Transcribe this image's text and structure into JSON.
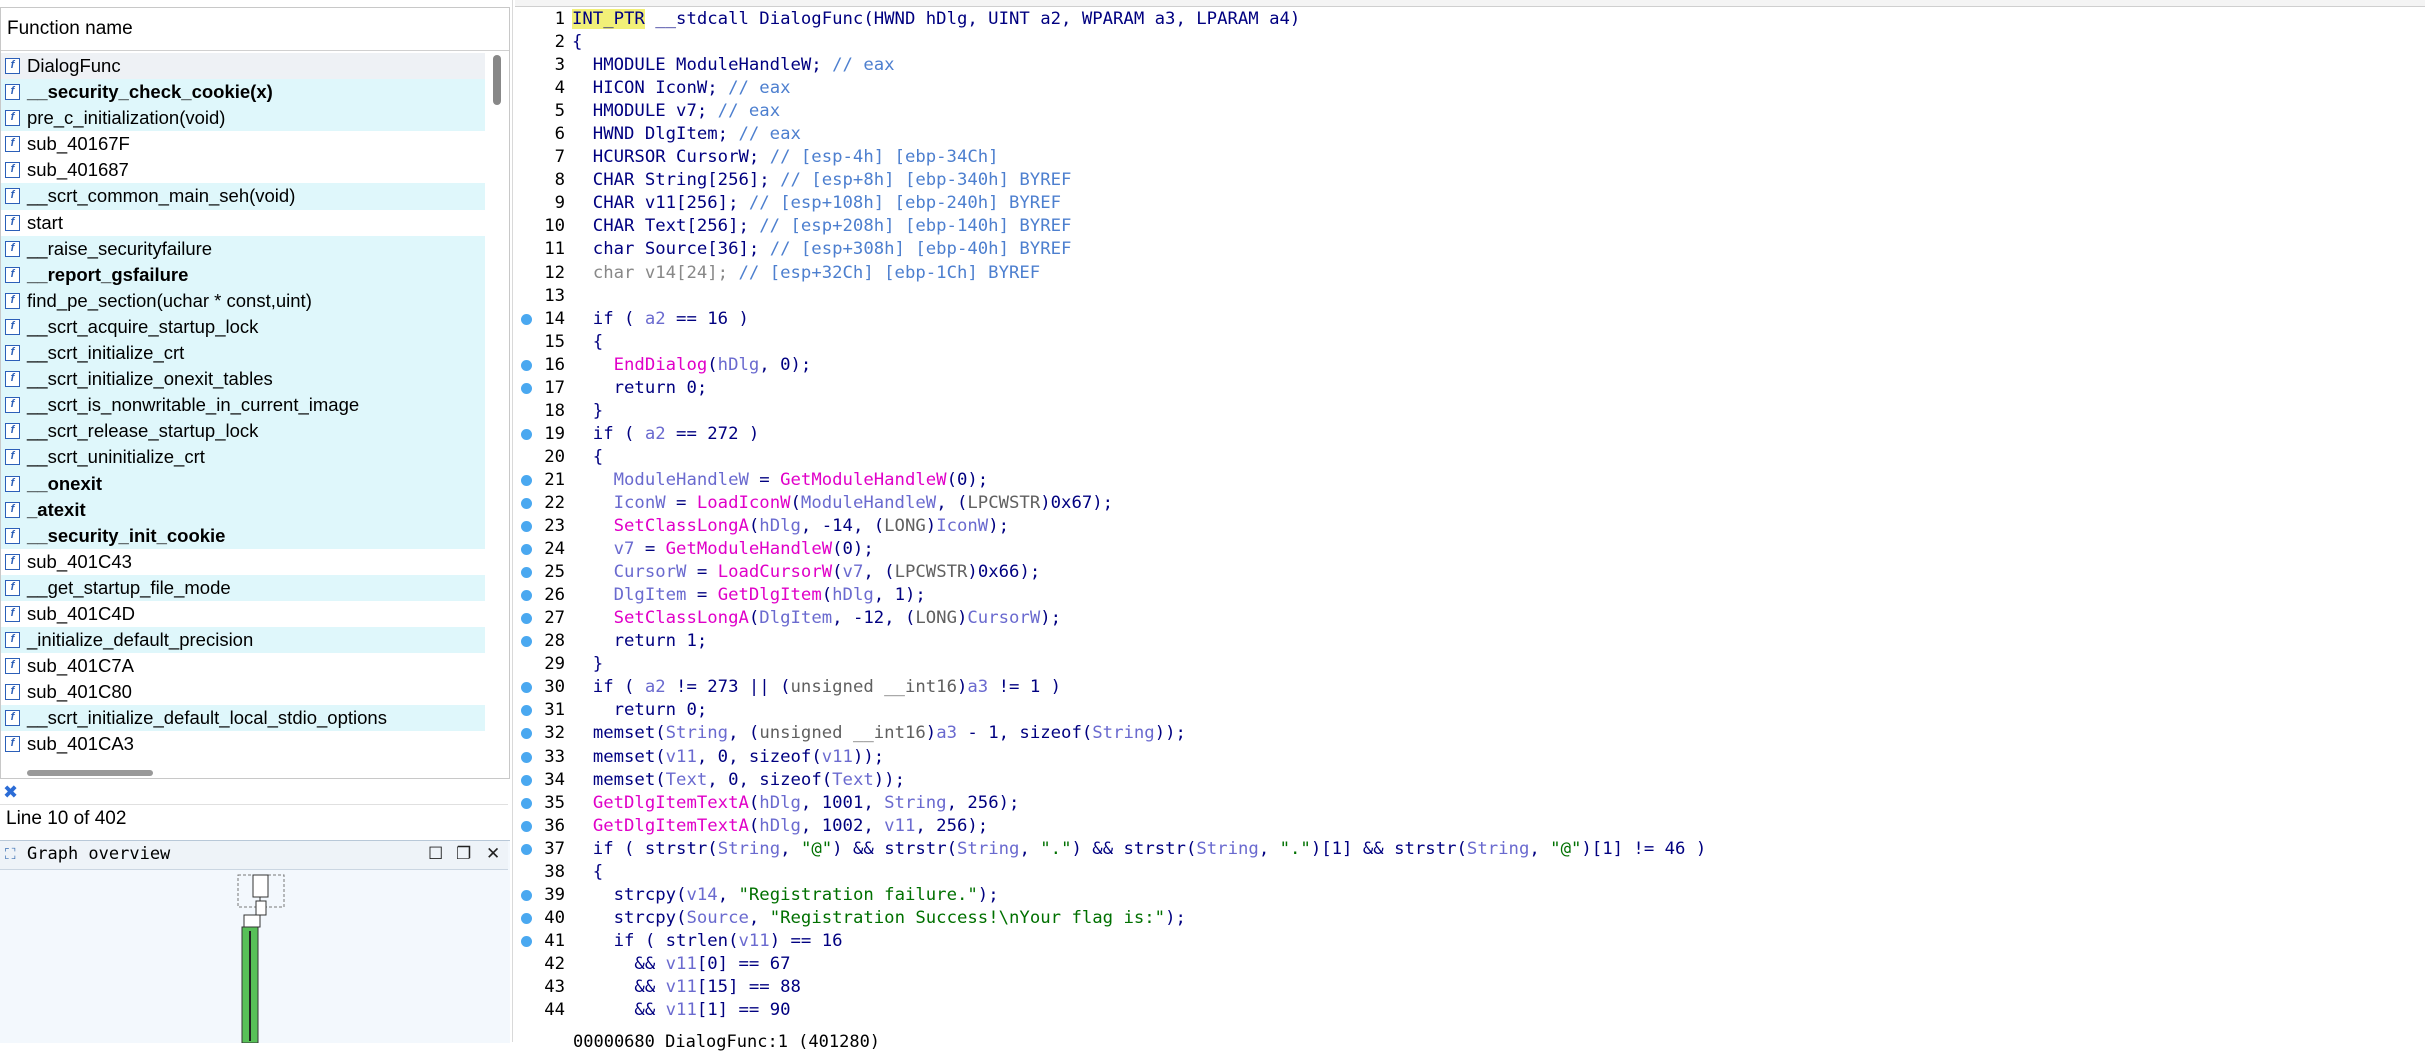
{
  "functions_panel": {
    "header": "Function name",
    "items": [
      {
        "name": "DialogFunc",
        "bold": false,
        "lib": false,
        "sel": true
      },
      {
        "name": "__security_check_cookie(x)",
        "bold": true,
        "lib": true
      },
      {
        "name": "pre_c_initialization(void)",
        "bold": false,
        "lib": true
      },
      {
        "name": "sub_40167F",
        "bold": false,
        "lib": false
      },
      {
        "name": "sub_401687",
        "bold": false,
        "lib": false
      },
      {
        "name": "__scrt_common_main_seh(void)",
        "bold": false,
        "lib": true
      },
      {
        "name": "start",
        "bold": false,
        "lib": false
      },
      {
        "name": "__raise_securityfailure",
        "bold": false,
        "lib": true
      },
      {
        "name": "__report_gsfailure",
        "bold": true,
        "lib": true
      },
      {
        "name": "find_pe_section(uchar * const,uint)",
        "bold": false,
        "lib": true
      },
      {
        "name": "__scrt_acquire_startup_lock",
        "bold": false,
        "lib": true
      },
      {
        "name": "__scrt_initialize_crt",
        "bold": false,
        "lib": true
      },
      {
        "name": "__scrt_initialize_onexit_tables",
        "bold": false,
        "lib": true
      },
      {
        "name": "__scrt_is_nonwritable_in_current_image",
        "bold": false,
        "lib": true
      },
      {
        "name": "__scrt_release_startup_lock",
        "bold": false,
        "lib": true
      },
      {
        "name": "__scrt_uninitialize_crt",
        "bold": false,
        "lib": true
      },
      {
        "name": "__onexit",
        "bold": true,
        "lib": true
      },
      {
        "name": "_atexit",
        "bold": true,
        "lib": true
      },
      {
        "name": "__security_init_cookie",
        "bold": true,
        "lib": true
      },
      {
        "name": "sub_401C43",
        "bold": false,
        "lib": false
      },
      {
        "name": "__get_startup_file_mode",
        "bold": false,
        "lib": true
      },
      {
        "name": "sub_401C4D",
        "bold": false,
        "lib": false
      },
      {
        "name": "_initialize_default_precision",
        "bold": false,
        "lib": true
      },
      {
        "name": "sub_401C7A",
        "bold": false,
        "lib": false
      },
      {
        "name": "sub_401C80",
        "bold": false,
        "lib": false
      },
      {
        "name": "__scrt_initialize_default_local_stdio_options",
        "bold": false,
        "lib": true
      },
      {
        "name": "sub_401CA3",
        "bold": false,
        "lib": false
      }
    ]
  },
  "status": {
    "line_count": "Line 10 of 402",
    "bottom_address": "00000680 DialogFunc:1 (401280)"
  },
  "graph_overview": {
    "title": "Graph overview",
    "icon": "graph-icon"
  },
  "code_lines": [
    {
      "n": "1",
      "dot": false,
      "html": "<span class=\"hl\">INT_PTR</span> __stdcall DialogFunc(HWND hDlg, UINT a2, WPARAM a3, LPARAM a4)"
    },
    {
      "n": "2",
      "dot": false,
      "html": "{"
    },
    {
      "n": "3",
      "dot": false,
      "html": "  HMODULE ModuleHandleW; <span class=\"cmt\">// eax</span>"
    },
    {
      "n": "4",
      "dot": false,
      "html": "  HICON IconW; <span class=\"cmt\">// eax</span>"
    },
    {
      "n": "5",
      "dot": false,
      "html": "  HMODULE v7; <span class=\"cmt\">// eax</span>"
    },
    {
      "n": "6",
      "dot": false,
      "html": "  HWND DlgItem; <span class=\"cmt\">// eax</span>"
    },
    {
      "n": "7",
      "dot": false,
      "html": "  HCURSOR CursorW; <span class=\"cmt\">// [esp-4h] [ebp-34Ch]</span>"
    },
    {
      "n": "8",
      "dot": false,
      "html": "  CHAR String[256]; <span class=\"cmt\">// [esp+8h] [ebp-340h] BYREF</span>"
    },
    {
      "n": "9",
      "dot": false,
      "html": "  CHAR v11[256]; <span class=\"cmt\">// [esp+108h] [ebp-240h] BYREF</span>"
    },
    {
      "n": "10",
      "dot": false,
      "html": "  CHAR Text[256]; <span class=\"cmt\">// [esp+208h] [ebp-140h] BYREF</span>"
    },
    {
      "n": "11",
      "dot": false,
      "html": "  char Source[36]; <span class=\"cmt\">// [esp+308h] [ebp-40h] BYREF</span>"
    },
    {
      "n": "12",
      "dot": false,
      "html": "  <span class=\"cmtv\">char v14[24];</span> <span class=\"cmt\">// [esp+32Ch] [ebp-1Ch] BYREF</span>"
    },
    {
      "n": "13",
      "dot": false,
      "html": ""
    },
    {
      "n": "14",
      "dot": true,
      "html": "  if ( <span class=\"var\">a2</span> == 16 )"
    },
    {
      "n": "15",
      "dot": false,
      "html": "  {"
    },
    {
      "n": "16",
      "dot": true,
      "html": "    <span class=\"fn\">EndDialog</span>(<span class=\"var\">hDlg</span>, 0);"
    },
    {
      "n": "17",
      "dot": true,
      "html": "    return 0;"
    },
    {
      "n": "18",
      "dot": false,
      "html": "  }"
    },
    {
      "n": "19",
      "dot": true,
      "html": "  if ( <span class=\"var\">a2</span> == 272 )"
    },
    {
      "n": "20",
      "dot": false,
      "html": "  {"
    },
    {
      "n": "21",
      "dot": true,
      "html": "    <span class=\"var\">ModuleHandleW</span> = <span class=\"fn\">GetModuleHandleW</span>(0);"
    },
    {
      "n": "22",
      "dot": true,
      "html": "    <span class=\"var\">IconW</span> = <span class=\"fn\">LoadIconW</span>(<span class=\"var\">ModuleHandleW</span>, (<span class=\"cast\">LPCWSTR</span>)0x67);"
    },
    {
      "n": "23",
      "dot": true,
      "html": "    <span class=\"fn\">SetClassLongA</span>(<span class=\"var\">hDlg</span>, -14, (<span class=\"cast\">LONG</span>)<span class=\"var\">IconW</span>);"
    },
    {
      "n": "24",
      "dot": true,
      "html": "    <span class=\"var\">v7</span> = <span class=\"fn\">GetModuleHandleW</span>(0);"
    },
    {
      "n": "25",
      "dot": true,
      "html": "    <span class=\"var\">CursorW</span> = <span class=\"fn\">LoadCursorW</span>(<span class=\"var\">v7</span>, (<span class=\"cast\">LPCWSTR</span>)0x66);"
    },
    {
      "n": "26",
      "dot": true,
      "html": "    <span class=\"var\">DlgItem</span> = <span class=\"fn\">GetDlgItem</span>(<span class=\"var\">hDlg</span>, 1);"
    },
    {
      "n": "27",
      "dot": true,
      "html": "    <span class=\"fn\">SetClassLongA</span>(<span class=\"var\">DlgItem</span>, -12, (<span class=\"cast\">LONG</span>)<span class=\"var\">CursorW</span>);"
    },
    {
      "n": "28",
      "dot": true,
      "html": "    return 1;"
    },
    {
      "n": "29",
      "dot": false,
      "html": "  }"
    },
    {
      "n": "30",
      "dot": true,
      "html": "  if ( <span class=\"var\">a2</span> != 273 || (<span class=\"cast\">unsigned __int16</span>)<span class=\"var\">a3</span> != 1 )"
    },
    {
      "n": "31",
      "dot": true,
      "html": "    return 0;"
    },
    {
      "n": "32",
      "dot": true,
      "html": "  <span class=\"kw\">memset</span>(<span class=\"var\">String</span>, (<span class=\"cast\">unsigned __int16</span>)<span class=\"var\">a3</span> - 1, sizeof(<span class=\"var\">String</span>));"
    },
    {
      "n": "33",
      "dot": true,
      "html": "  <span class=\"kw\">memset</span>(<span class=\"var\">v11</span>, 0, sizeof(<span class=\"var\">v11</span>));"
    },
    {
      "n": "34",
      "dot": true,
      "html": "  <span class=\"kw\">memset</span>(<span class=\"var\">Text</span>, 0, sizeof(<span class=\"var\">Text</span>));"
    },
    {
      "n": "35",
      "dot": true,
      "html": "  <span class=\"fn\">GetDlgItemTextA</span>(<span class=\"var\">hDlg</span>, 1001, <span class=\"var\">String</span>, 256);"
    },
    {
      "n": "36",
      "dot": true,
      "html": "  <span class=\"fn\">GetDlgItemTextA</span>(<span class=\"var\">hDlg</span>, 1002, <span class=\"var\">v11</span>, 256);"
    },
    {
      "n": "37",
      "dot": true,
      "html": "  if ( <span class=\"kw\">strstr</span>(<span class=\"var\">String</span>, <span class=\"str\">\"@\"</span>) &amp;&amp; <span class=\"kw\">strstr</span>(<span class=\"var\">String</span>, <span class=\"str\">\".\"</span>) &amp;&amp; <span class=\"kw\">strstr</span>(<span class=\"var\">String</span>, <span class=\"str\">\".\"</span>)[1] &amp;&amp; <span class=\"kw\">strstr</span>(<span class=\"var\">String</span>, <span class=\"str\">\"@\"</span>)[1] != 46 )"
    },
    {
      "n": "38",
      "dot": false,
      "html": "  {"
    },
    {
      "n": "39",
      "dot": true,
      "html": "    <span class=\"kw\">strcpy</span>(<span class=\"var\">v14</span>, <span class=\"str\">\"Registration failure.\"</span>);"
    },
    {
      "n": "40",
      "dot": true,
      "html": "    <span class=\"kw\">strcpy</span>(<span class=\"var\">Source</span>, <span class=\"str\">\"Registration Success!\\nYour flag is:\"</span>);"
    },
    {
      "n": "41",
      "dot": true,
      "html": "    if ( <span class=\"kw\">strlen</span>(<span class=\"var\">v11</span>) == 16"
    },
    {
      "n": "42",
      "dot": false,
      "html": "      &amp;&amp; <span class=\"var\">v11</span>[0] == 67"
    },
    {
      "n": "43",
      "dot": false,
      "html": "      &amp;&amp; <span class=\"var\">v11</span>[15] == 88"
    },
    {
      "n": "44",
      "dot": false,
      "html": "      &amp;&amp; <span class=\"var\">v11</span>[1] == 90"
    }
  ],
  "colors": {
    "lib_row": "#dff7fb",
    "breakpoint_dot": "#4aa8f0",
    "api_call": "#e000c8",
    "string": "#007000"
  }
}
